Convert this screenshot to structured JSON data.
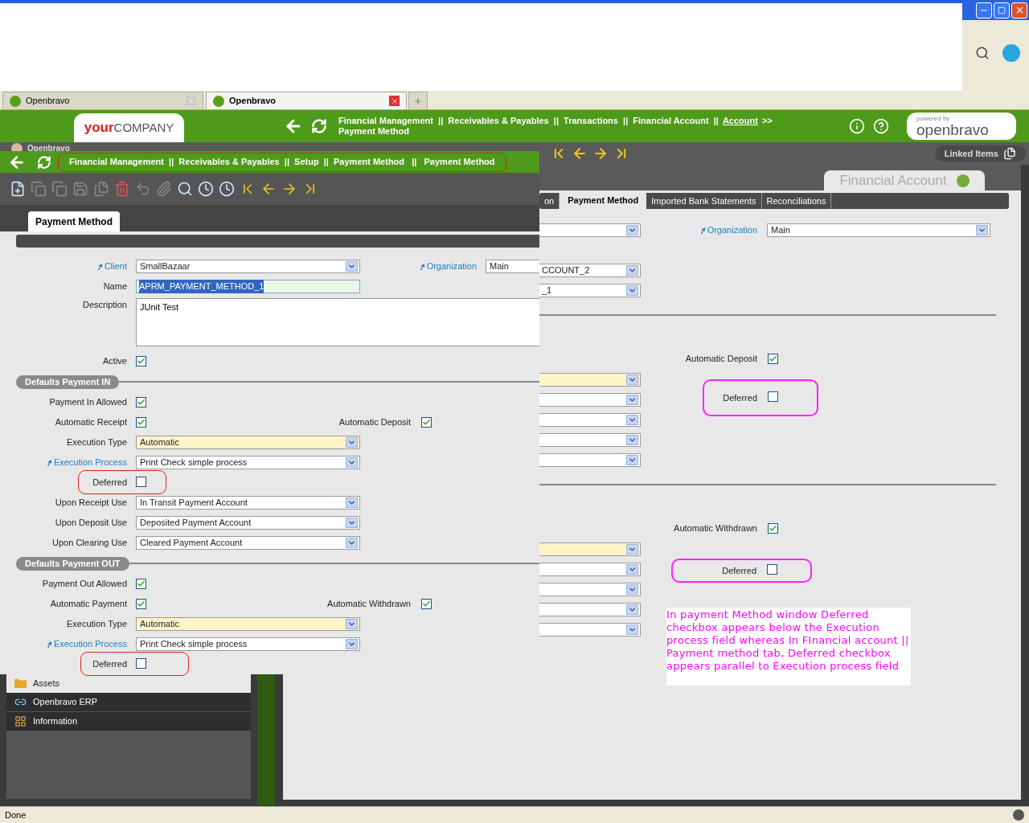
{
  "browser": {
    "tabs": [
      {
        "label": "Openbravo",
        "selected": false
      },
      {
        "label": "Openbravo",
        "selected": true
      }
    ]
  },
  "app_header": {
    "company_logo": {
      "bold": "your",
      "rest": "COMPANY"
    },
    "breadcrumb": {
      "path": "Financial Management  ||  Receivables & Payables  ||  Transactions  ||  Financial Account  ||",
      "link": "Account",
      "more": ">>",
      "current": "Payment Method"
    },
    "powered_logo": {
      "caption": "powered by",
      "name": "openbravo"
    }
  },
  "sidebar": {
    "user": "Openbravo",
    "items": [
      {
        "label": "Assets",
        "kind": "folder"
      },
      {
        "label": "Openbravo ERP",
        "kind": "group"
      },
      {
        "label": "Information",
        "kind": "group"
      }
    ]
  },
  "toolbar": {
    "linked_items": "Linked Items"
  },
  "financial_account_window": {
    "title": "Financial Account",
    "tabs": [
      {
        "label": "on",
        "selected": false
      },
      {
        "label": "Payment Method",
        "selected": true
      },
      {
        "label": "Imported Bank Statements",
        "selected": false
      },
      {
        "label": "Reconciliations",
        "selected": false
      }
    ],
    "form": {
      "top_field": {
        "required": false
      },
      "organization": {
        "label": "Organization",
        "value": "Main"
      },
      "account_fields": [
        {
          "value": "CCOUNT_2"
        },
        {
          "value": "_1"
        }
      ],
      "sections": [
        {
          "check": {
            "label": "Automatic Deposit",
            "checked": true
          },
          "fields": [
            {
              "required": true
            },
            {
              "required": false
            },
            {
              "required": false
            },
            {
              "required": false
            },
            {
              "required": false
            }
          ],
          "deferred": {
            "label": "Deferred",
            "checked": false
          }
        },
        {
          "check": {
            "label": "Automatic Withdrawn",
            "checked": true
          },
          "fields": [
            {
              "required": true
            },
            {
              "required": false
            },
            {
              "required": false
            },
            {
              "required": false
            },
            {
              "required": false
            }
          ],
          "deferred": {
            "label": "Deferred",
            "checked": false
          }
        }
      ],
      "note": "In payment Method window Deferred checkbox appears below the Execution process field whereas In FInancial account || Payment method tab, Deferred checkbox appears parallel to Execution process field"
    }
  },
  "payment_method_window": {
    "breadcrumb": "Financial Management  ||  Receivables & Payables  ||  Setup  ||  Payment Method   ||   Payment Method",
    "tab": {
      "label": "Payment Method",
      "selected": true
    },
    "client": {
      "label": "Client",
      "value": "SmallBazaar"
    },
    "organization": {
      "label": "Organization",
      "value": "Main"
    },
    "name": {
      "label": "Name",
      "value": "APRM_PAYMENT_METHOD_1"
    },
    "description": {
      "label": "Description",
      "value": "JUnit Test"
    },
    "active": {
      "label": "Active",
      "checked": true
    },
    "sections": [
      {
        "title": "Defaults Payment IN",
        "rows": [
          {
            "kind": "checkbox",
            "label": "Payment In Allowed",
            "checked": true,
            "highlighted": false
          },
          {
            "kind": "checkbox",
            "label": "Automatic Receipt",
            "checked": true,
            "highlighted": false,
            "side": {
              "label": "Automatic Deposit",
              "checked": true
            }
          },
          {
            "kind": "select",
            "label": "Execution Type",
            "value": "Automatic",
            "required": true,
            "link": false
          },
          {
            "kind": "select",
            "label": "Execution Process",
            "value": "Print Check simple process",
            "required": false,
            "link": true
          },
          {
            "kind": "checkbox",
            "label": "Deferred",
            "checked": false,
            "highlighted": true
          },
          {
            "kind": "select",
            "label": "Upon Receipt Use",
            "value": "In Transit Payment Account",
            "required": false,
            "link": false
          },
          {
            "kind": "select",
            "label": "Upon Deposit Use",
            "value": "Deposited Payment Account",
            "required": false,
            "link": false
          },
          {
            "kind": "select",
            "label": "Upon Clearing Use",
            "value": "Cleared Payment Account",
            "required": false,
            "link": false
          }
        ]
      },
      {
        "title": "Defaults Payment OUT",
        "rows": [
          {
            "kind": "checkbox",
            "label": "Payment Out Allowed",
            "checked": true,
            "highlighted": false
          },
          {
            "kind": "checkbox",
            "label": "Automatic Payment",
            "checked": true,
            "highlighted": false,
            "side": {
              "label": "Automatic Withdrawn",
              "checked": true
            }
          },
          {
            "kind": "select",
            "label": "Execution Type",
            "value": "Automatic",
            "required": true,
            "link": false
          },
          {
            "kind": "select",
            "label": "Execution Process",
            "value": "Print Check simple process",
            "required": false,
            "link": true
          },
          {
            "kind": "checkbox",
            "label": "Deferred",
            "checked": false,
            "highlighted": true
          }
        ]
      }
    ]
  },
  "status_bar": {
    "text": "Done"
  }
}
